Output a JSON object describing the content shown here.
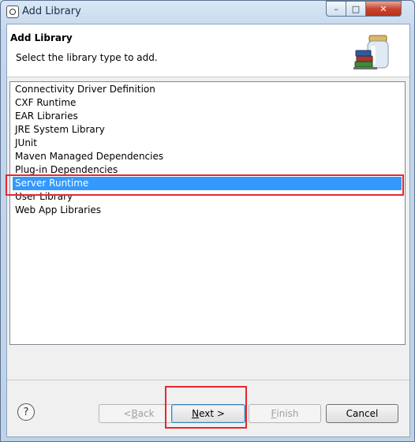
{
  "window": {
    "title": "Add Library"
  },
  "titlebar": {
    "minimize": "–",
    "maximize": "□",
    "close": "✕"
  },
  "header": {
    "title": "Add Library",
    "description": "Select the library type to add.",
    "icon": "library-jars-icon"
  },
  "library_list": {
    "items": [
      {
        "label": "Connectivity Driver Definition",
        "selected": false
      },
      {
        "label": "CXF Runtime",
        "selected": false
      },
      {
        "label": "EAR Libraries",
        "selected": false
      },
      {
        "label": "JRE System Library",
        "selected": false
      },
      {
        "label": "JUnit",
        "selected": false
      },
      {
        "label": "Maven Managed Dependencies",
        "selected": false
      },
      {
        "label": "Plug-in Dependencies",
        "selected": false
      },
      {
        "label": "Server Runtime",
        "selected": true
      },
      {
        "label": "User Library",
        "selected": false
      },
      {
        "label": "Web App Libraries",
        "selected": false
      }
    ]
  },
  "footer": {
    "help": "?",
    "back_prefix": "< ",
    "back_mnemonic": "B",
    "back_rest": "ack",
    "next_prefix": "",
    "next_mnemonic": "N",
    "next_rest": "ext >",
    "finish_mnemonic": "F",
    "finish_rest": "inish",
    "cancel": "Cancel"
  },
  "colors": {
    "selection": "#3399ff",
    "highlight": "#e8262c"
  }
}
